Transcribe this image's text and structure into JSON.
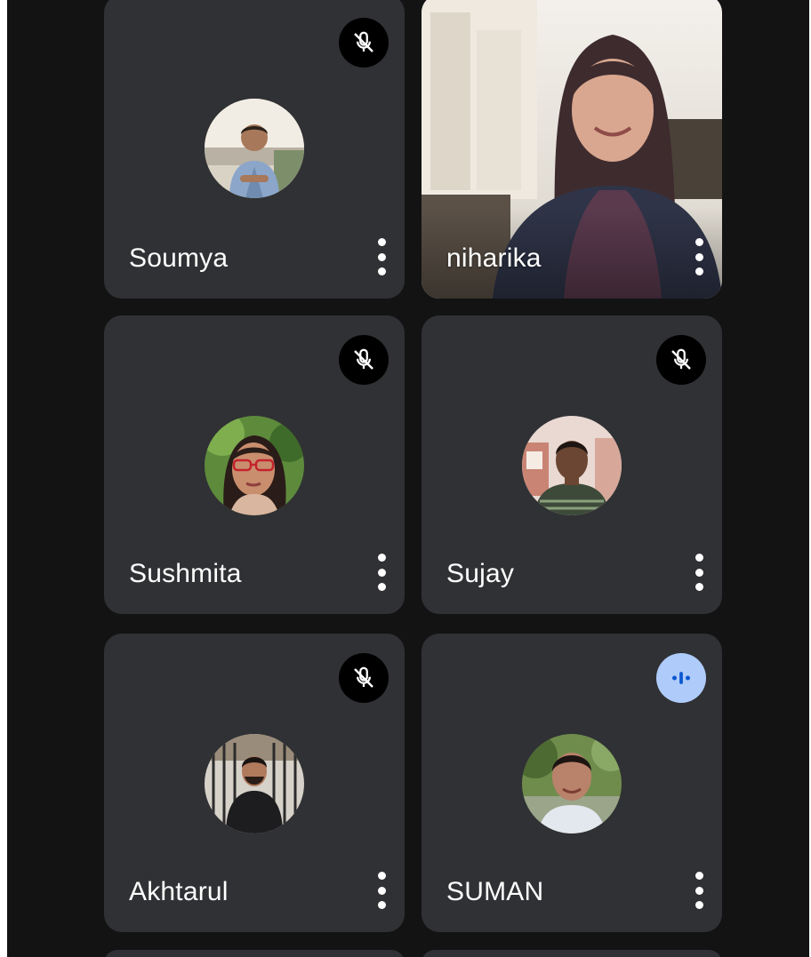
{
  "participants": [
    {
      "name": "Soumya",
      "muted": true,
      "speaking": false,
      "video": false
    },
    {
      "name": "niharika",
      "muted": false,
      "speaking": false,
      "video": true
    },
    {
      "name": "Sushmita",
      "muted": true,
      "speaking": false,
      "video": false
    },
    {
      "name": "Sujay",
      "muted": true,
      "speaking": false,
      "video": false
    },
    {
      "name": "Akhtarul",
      "muted": true,
      "speaking": false,
      "video": false
    },
    {
      "name": "SUMAN",
      "muted": false,
      "speaking": true,
      "video": false
    }
  ],
  "icons": {
    "mic_off": "mic-off-icon",
    "speaking": "audio-level-icon",
    "more": "more-vert-icon"
  },
  "colors": {
    "background": "#131314",
    "tile": "#303134",
    "speaking_badge": "#aecbfa",
    "speaking_icon": "#0b57d0"
  }
}
